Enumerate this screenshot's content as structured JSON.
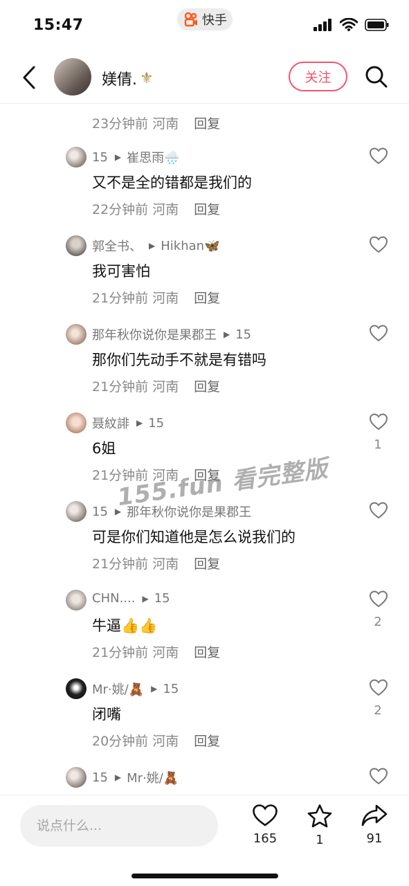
{
  "status_bar": {
    "time": "15:47",
    "app_name": "快手"
  },
  "header": {
    "username": "媄倩.",
    "name_badge": "⚜",
    "follow_label": "关注"
  },
  "top_meta": {
    "time": "23分钟前",
    "region": "河南",
    "reply": "回复"
  },
  "comments": [
    {
      "author": "15",
      "arrow": "▶",
      "target": "崔思雨🌧️",
      "text": "又不是全的错都是我们的",
      "time": "22分钟前",
      "region": "河南",
      "reply": "回复",
      "likes": ""
    },
    {
      "author": "郭全书、",
      "arrow": "▶",
      "target": "Hikhan🦋",
      "text": "我可害怕",
      "time": "21分钟前",
      "region": "河南",
      "reply": "回复",
      "likes": ""
    },
    {
      "author": "那年秋你说你是果郡王",
      "arrow": "▶",
      "target": "15",
      "text": "那你们先动手不就是有错吗",
      "time": "21分钟前",
      "region": "河南",
      "reply": "回复",
      "likes": ""
    },
    {
      "author": "聂紋誹",
      "arrow": "▶",
      "target": "15",
      "text": "6姐",
      "time": "21分钟前",
      "region": "河南",
      "reply": "回复",
      "likes": "1"
    },
    {
      "author": "15",
      "arrow": "▶",
      "target": "那年秋你说你是果郡王",
      "text": "可是你们知道他是怎么说我们的",
      "time": "21分钟前",
      "region": "河南",
      "reply": "回复",
      "likes": ""
    },
    {
      "author": "CHN....",
      "arrow": "▶",
      "target": "15",
      "text": "牛逼👍👍",
      "time": "21分钟前",
      "region": "河南",
      "reply": "回复",
      "likes": "2"
    },
    {
      "author": "Mr·姚/🧸",
      "arrow": "▶",
      "target": "15",
      "text": "闭嘴",
      "time": "20分钟前",
      "region": "河南",
      "reply": "回复",
      "likes": "2"
    },
    {
      "author": "15",
      "arrow": "▶",
      "target": "Mr·姚/🧸",
      "text": "",
      "time": "",
      "region": "",
      "reply": "",
      "likes": ""
    }
  ],
  "watermark": "155.fun 看完整版",
  "bottom_bar": {
    "input_placeholder": "说点什么...",
    "like_count": "165",
    "favorite_count": "1",
    "share_count": "91"
  },
  "colors": {
    "accent": "#f0566e",
    "meta_gray": "#888888",
    "input_bg": "#f1f1f1"
  },
  "icons": [
    "back-arrow-icon",
    "search-icon",
    "heart-icon",
    "star-icon",
    "share-icon",
    "signal-icon",
    "wifi-icon",
    "battery-icon"
  ]
}
